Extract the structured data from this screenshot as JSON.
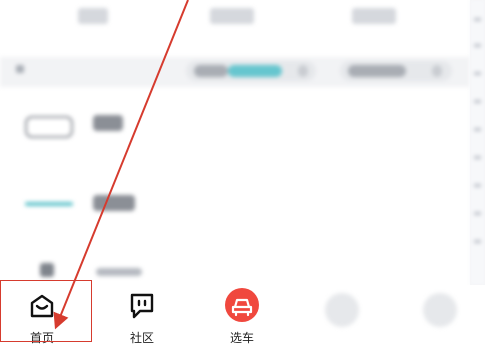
{
  "bottom_nav": {
    "items": [
      {
        "label": "首页",
        "icon": "home-icon",
        "active": true
      },
      {
        "label": "社区",
        "icon": "message-square-icon",
        "active": false
      },
      {
        "label": "选车",
        "icon": "car-icon",
        "active": false
      }
    ]
  },
  "colors": {
    "accent_red": "#f0483e",
    "annotation_red": "#d63b2e",
    "teal": "#5fc8c8"
  }
}
